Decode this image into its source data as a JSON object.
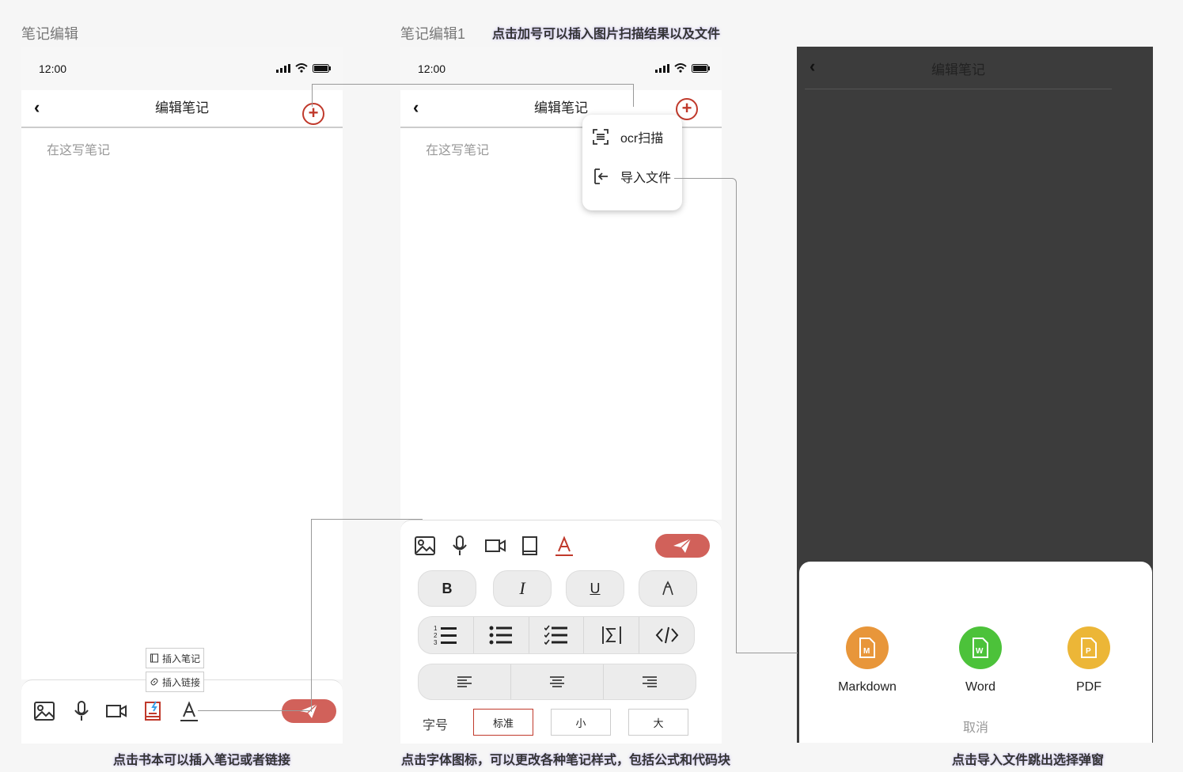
{
  "frames": {
    "f1": {
      "title": "笔记编辑"
    },
    "f2": {
      "title": "笔记编辑1",
      "note": "点击加号可以插入图片扫描结果以及文件"
    },
    "f1_note": "点击书本可以插入笔记或者链接",
    "f2_note": "点击字体图标，可以更改各种笔记样式，包括公式和代码块",
    "f3_note": "点击导入文件跳出选择弹窗"
  },
  "status": {
    "time": "12:00"
  },
  "nav": {
    "title": "编辑笔记",
    "back": "‹"
  },
  "editor": {
    "placeholder": "在这写笔记"
  },
  "popup": {
    "ocr": "ocr扫描",
    "import": "导入文件"
  },
  "insert_menu": {
    "note": "插入笔记",
    "link": "插入链接"
  },
  "format": {
    "bold": "B",
    "italic": "I",
    "underline": "U",
    "font_size_label": "字号",
    "sizes": [
      "标准",
      "小",
      "大"
    ],
    "selected_size": "标准"
  },
  "sheet": {
    "types": [
      {
        "label": "Markdown",
        "letter": "M",
        "color": "#e8963a"
      },
      {
        "label": "Word",
        "letter": "W",
        "color": "#4cc23a"
      },
      {
        "label": "PDF",
        "letter": "P",
        "color": "#ecb637"
      }
    ],
    "cancel": "取消"
  },
  "colors": {
    "accent": "#c0392b",
    "send": "#d1615a",
    "dark_overlay": "#3c3c3c"
  }
}
